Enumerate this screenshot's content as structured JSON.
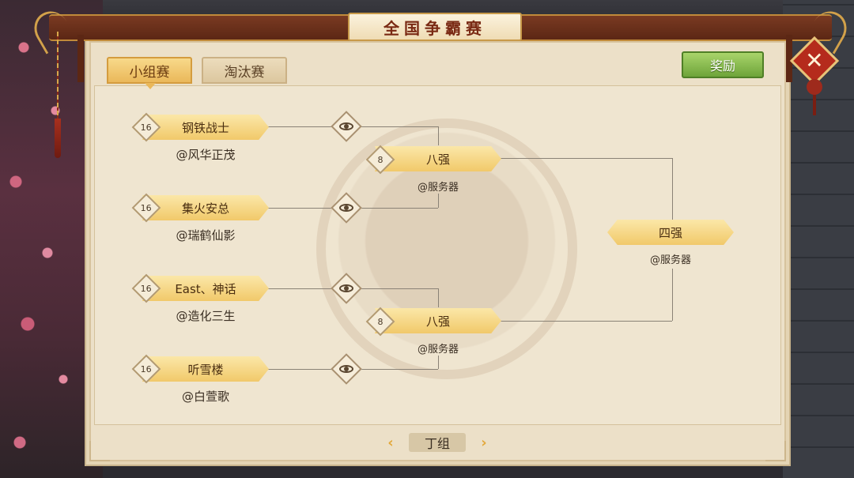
{
  "title": "全国争霸赛",
  "tabs": [
    {
      "label": "小组赛",
      "active": true
    },
    {
      "label": "淘汰赛",
      "active": false
    }
  ],
  "reward_label": "奖励",
  "close_icon": "close-icon",
  "round16": [
    {
      "seed": "16",
      "team": "钢铁战士",
      "server": "@风华正茂"
    },
    {
      "seed": "16",
      "team": "集火安总",
      "server": "@瑞鹤仙影"
    },
    {
      "seed": "16",
      "team": "East、神话",
      "server": "@造化三生"
    },
    {
      "seed": "16",
      "team": "听雪楼",
      "server": "@白萱歌"
    }
  ],
  "quarter": [
    {
      "seed": "8",
      "team": "八强",
      "server": "@服务器"
    },
    {
      "seed": "8",
      "team": "八强",
      "server": "@服务器"
    }
  ],
  "semi": {
    "team": "四强",
    "server": "@服务器"
  },
  "group_nav": {
    "prev": "‹",
    "current": "丁组",
    "next": "›"
  },
  "colors": {
    "plate": "#f1c96a",
    "panel": "#ece0c8",
    "title_bar": "#5c2714",
    "reward": "#6ea43a",
    "close": "#b52b1c"
  }
}
